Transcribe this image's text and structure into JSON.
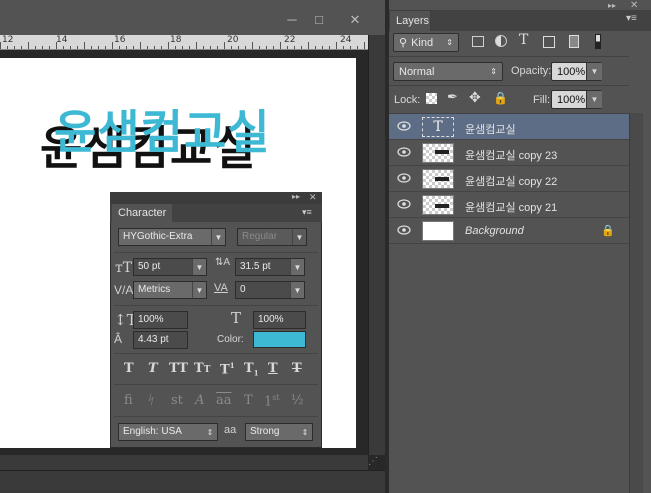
{
  "ruler": {
    "labels": [
      "12",
      "14",
      "16",
      "18",
      "20",
      "22",
      "24"
    ]
  },
  "canvas": {
    "headline": "윤샘컴교실"
  },
  "layers": {
    "tab": "Layers",
    "filter": {
      "kind": "Kind"
    },
    "blend": {
      "mode": "Normal",
      "opacity_label": "Opacity:",
      "opacity": "100%"
    },
    "lock": {
      "label": "Lock:",
      "fill_label": "Fill:",
      "fill": "100%"
    },
    "items": [
      {
        "name": "윤샘컴교실",
        "type": "text",
        "active": true
      },
      {
        "name": "윤샘컴교실 copy 23",
        "type": "raster",
        "active": false
      },
      {
        "name": "윤샘컴교실 copy 22",
        "type": "raster",
        "active": false
      },
      {
        "name": "윤샘컴교실 copy 21",
        "type": "raster",
        "active": false
      },
      {
        "name": "Background",
        "type": "background",
        "active": false,
        "locked": true
      }
    ]
  },
  "character": {
    "tab": "Character",
    "font_family": "HYGothic-Extra",
    "font_style": "Regular",
    "size": "50 pt",
    "leading": "31.5 pt",
    "kerning": "Metrics",
    "tracking": "0",
    "vscale": "100%",
    "hscale": "100%",
    "baseline": "4.43 pt",
    "color_label": "Color:",
    "color": "#3db9d3",
    "language": "English: USA",
    "aa_icon": "aa",
    "antialias": "Strong"
  }
}
